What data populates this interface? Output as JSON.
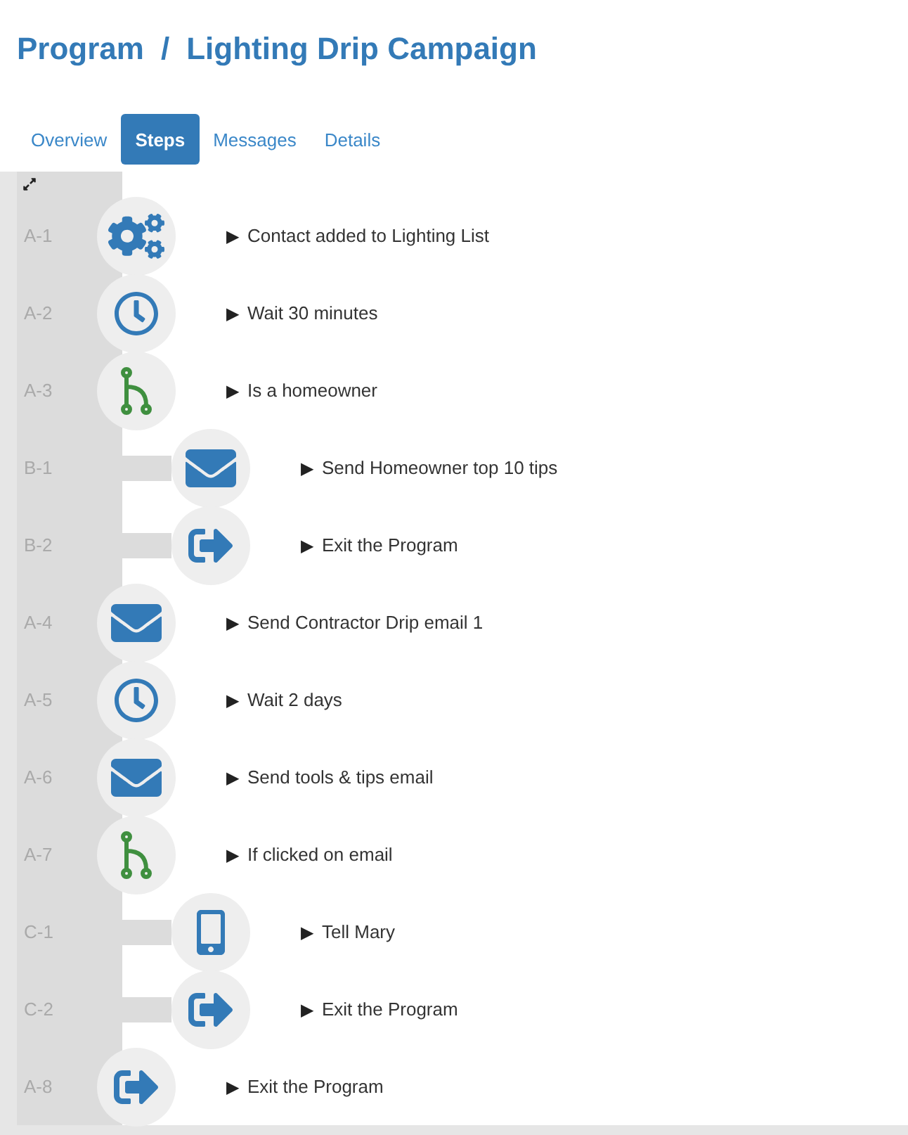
{
  "title": {
    "section": "Program",
    "separator": "/",
    "name": "Lighting Drip Campaign"
  },
  "tabs": [
    {
      "label": "Overview",
      "selected": false
    },
    {
      "label": "Steps",
      "selected": true
    },
    {
      "label": "Messages",
      "selected": false
    },
    {
      "label": "Details",
      "selected": false
    }
  ],
  "steps": [
    {
      "code": "A-1",
      "kind": "trigger",
      "triangle": "▶",
      "label": "Contact added to Lighting List"
    },
    {
      "code": "A-2",
      "kind": "wait",
      "triangle": "▶",
      "label": "Wait 30 minutes"
    },
    {
      "code": "A-3",
      "kind": "branch",
      "triangle": "▶",
      "label": "Is a homeowner",
      "children": [
        {
          "code": "B-1",
          "kind": "email",
          "triangle": "▶",
          "label": "Send Homeowner top 10 tips"
        },
        {
          "code": "B-2",
          "kind": "exit",
          "triangle": "▶",
          "label": "Exit the Program"
        }
      ]
    },
    {
      "code": "A-4",
      "kind": "email",
      "triangle": "▶",
      "label": "Send Contractor Drip email 1"
    },
    {
      "code": "A-5",
      "kind": "wait",
      "triangle": "▶",
      "label": "Wait 2 days"
    },
    {
      "code": "A-6",
      "kind": "email",
      "triangle": "▶",
      "label": "Send tools & tips email"
    },
    {
      "code": "A-7",
      "kind": "branch",
      "triangle": "▶",
      "label": "If clicked on email",
      "children": [
        {
          "code": "C-1",
          "kind": "sms",
          "triangle": "▶",
          "label": "Tell Mary"
        },
        {
          "code": "C-2",
          "kind": "exit",
          "triangle": "▶",
          "label": "Exit the Program"
        }
      ]
    },
    {
      "code": "A-8",
      "kind": "exit",
      "triangle": "▶",
      "label": "Exit the Program"
    }
  ]
}
